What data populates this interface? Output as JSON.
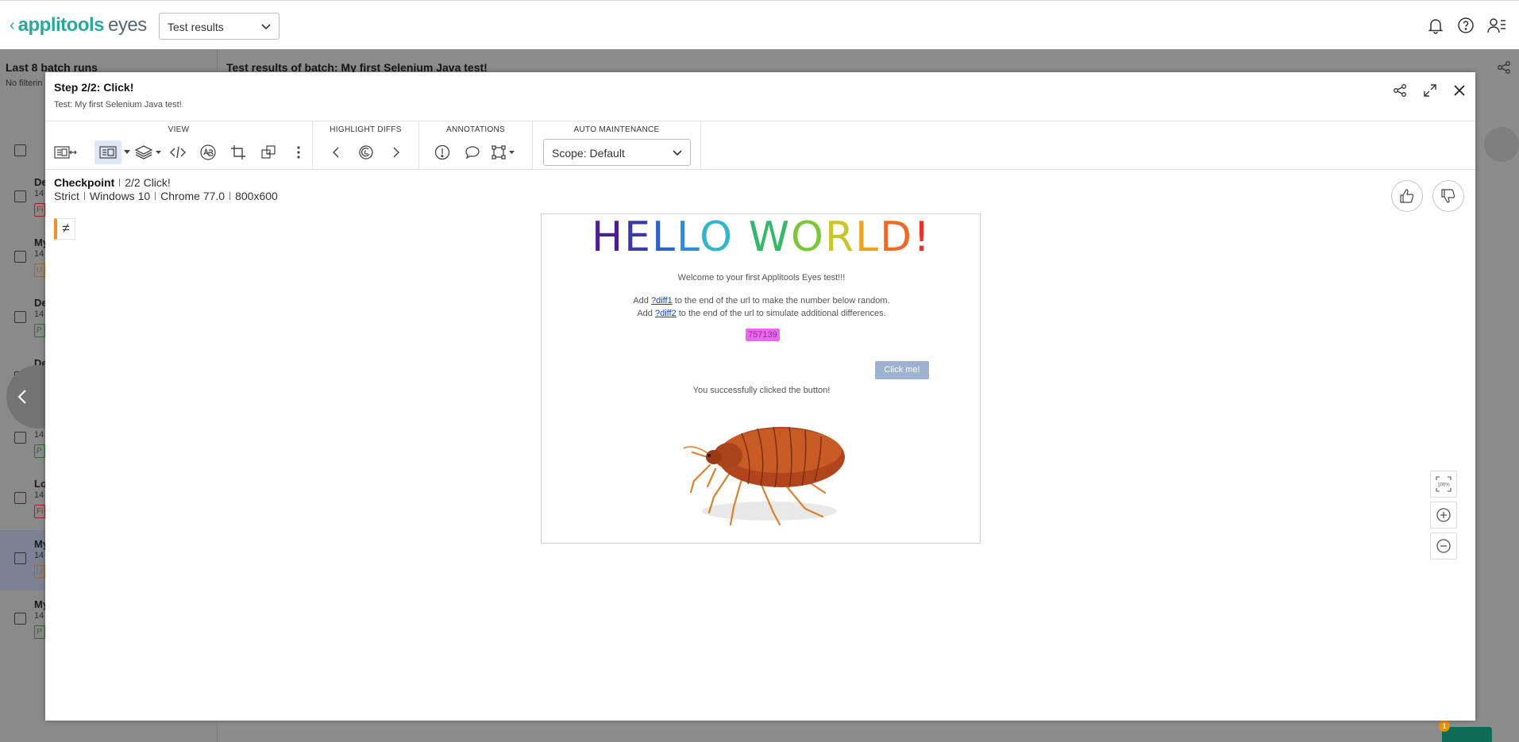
{
  "app": {
    "logo_primary": "applitools",
    "logo_secondary": "eyes",
    "view_select": "Test results"
  },
  "background": {
    "sidebar_title": "Last 8 batch runs",
    "sidebar_filter": "No filterin",
    "main_title": "Test results of batch: My first Selenium Java test!",
    "rows": [
      {
        "name": "De",
        "date": "14",
        "status": "Fi",
        "kind": "f"
      },
      {
        "name": "My",
        "date": "14",
        "status": "U",
        "kind": "u"
      },
      {
        "name": "De",
        "date": "14",
        "status": "P",
        "kind": "p"
      },
      {
        "name": "De",
        "date": "14",
        "status": "P",
        "kind": "p"
      },
      {
        "name": "Lo",
        "date": "14",
        "status": "P",
        "kind": "p"
      },
      {
        "name": "Lo",
        "date": "14",
        "status": "Fi",
        "kind": "f"
      },
      {
        "name": "My",
        "date": "14",
        "status": "U",
        "kind": "u"
      },
      {
        "name": "My",
        "date": "14",
        "status": "P",
        "kind": "p"
      }
    ],
    "chat_badge": "1"
  },
  "modal": {
    "title": "Step 2/2: Click!",
    "subtitle": "Test: My first Selenium Java test!",
    "groups": {
      "view": "VIEW",
      "highlight": "HIGHLIGHT DIFFS",
      "annotations": "ANNOTATIONS",
      "maintenance": "AUTO MAINTENANCE"
    },
    "scope": "Scope: Default",
    "checkpoint": {
      "label": "Checkpoint",
      "step": "2/2 Click!",
      "match_level": "Strict",
      "os": "Windows 10",
      "browser": "Chrome 77.0",
      "viewport": "800x600"
    },
    "diff_symbol": "≠",
    "zoom_fit_label": "100%"
  },
  "screenshot": {
    "hello_letters": [
      "H",
      "E",
      "L",
      "L",
      "O",
      " ",
      "W",
      "O",
      "R",
      "L",
      "D",
      "!"
    ],
    "hello_colors": [
      "#4b1f8c",
      "#3a3aa8",
      "#2f63c6",
      "#2a8fd6",
      "#34b6c8",
      "#ffffff",
      "#36b86a",
      "#7cc63a",
      "#c9c52b",
      "#f0a21f",
      "#ef6a23",
      "#e5342f"
    ],
    "welcome": "Welcome to your first Applitools Eyes test!!!",
    "add1_prefix": "Add ",
    "add1_link": "?diff1",
    "add1_suffix": " to the end of the url to make the number below random.",
    "add2_prefix": "Add ",
    "add2_link": "?diff2",
    "add2_suffix": " to the end of the url to simulate additional differences.",
    "random_number": "757139",
    "button": "Click me!",
    "success": "You successfully clicked the button!",
    "image": "bedbug-icon"
  },
  "colors": {
    "brand": "#2aa89a",
    "diff_highlight": "#ef65ef",
    "diff_marker": "#f28e2b",
    "active_tool": "#dfe8f5"
  }
}
